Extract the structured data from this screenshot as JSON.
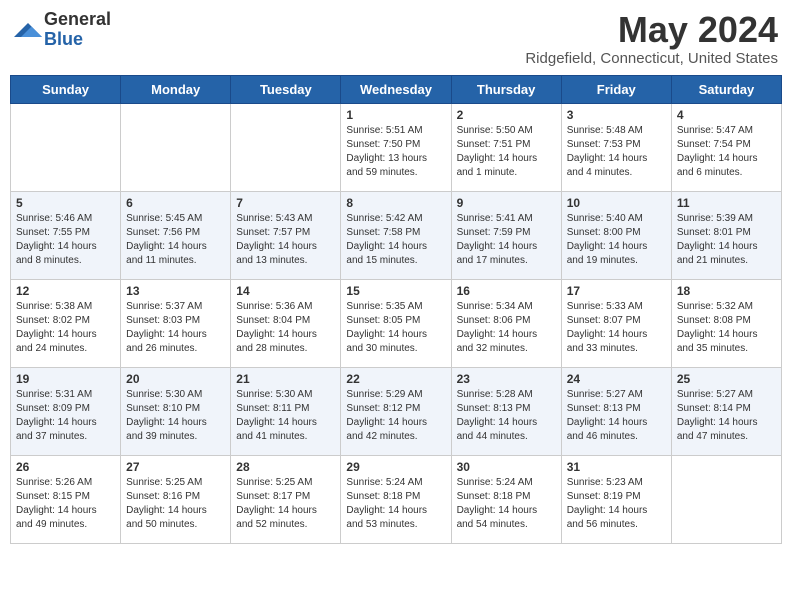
{
  "header": {
    "logo_general": "General",
    "logo_blue": "Blue",
    "month": "May 2024",
    "location": "Ridgefield, Connecticut, United States"
  },
  "days_of_week": [
    "Sunday",
    "Monday",
    "Tuesday",
    "Wednesday",
    "Thursday",
    "Friday",
    "Saturday"
  ],
  "weeks": [
    [
      {
        "day": "",
        "sunrise": "",
        "sunset": "",
        "daylight": ""
      },
      {
        "day": "",
        "sunrise": "",
        "sunset": "",
        "daylight": ""
      },
      {
        "day": "",
        "sunrise": "",
        "sunset": "",
        "daylight": ""
      },
      {
        "day": "1",
        "sunrise": "5:51 AM",
        "sunset": "7:50 PM",
        "daylight": "13 hours and 59 minutes."
      },
      {
        "day": "2",
        "sunrise": "5:50 AM",
        "sunset": "7:51 PM",
        "daylight": "14 hours and 1 minute."
      },
      {
        "day": "3",
        "sunrise": "5:48 AM",
        "sunset": "7:53 PM",
        "daylight": "14 hours and 4 minutes."
      },
      {
        "day": "4",
        "sunrise": "5:47 AM",
        "sunset": "7:54 PM",
        "daylight": "14 hours and 6 minutes."
      }
    ],
    [
      {
        "day": "5",
        "sunrise": "5:46 AM",
        "sunset": "7:55 PM",
        "daylight": "14 hours and 8 minutes."
      },
      {
        "day": "6",
        "sunrise": "5:45 AM",
        "sunset": "7:56 PM",
        "daylight": "14 hours and 11 minutes."
      },
      {
        "day": "7",
        "sunrise": "5:43 AM",
        "sunset": "7:57 PM",
        "daylight": "14 hours and 13 minutes."
      },
      {
        "day": "8",
        "sunrise": "5:42 AM",
        "sunset": "7:58 PM",
        "daylight": "14 hours and 15 minutes."
      },
      {
        "day": "9",
        "sunrise": "5:41 AM",
        "sunset": "7:59 PM",
        "daylight": "14 hours and 17 minutes."
      },
      {
        "day": "10",
        "sunrise": "5:40 AM",
        "sunset": "8:00 PM",
        "daylight": "14 hours and 19 minutes."
      },
      {
        "day": "11",
        "sunrise": "5:39 AM",
        "sunset": "8:01 PM",
        "daylight": "14 hours and 21 minutes."
      }
    ],
    [
      {
        "day": "12",
        "sunrise": "5:38 AM",
        "sunset": "8:02 PM",
        "daylight": "14 hours and 24 minutes."
      },
      {
        "day": "13",
        "sunrise": "5:37 AM",
        "sunset": "8:03 PM",
        "daylight": "14 hours and 26 minutes."
      },
      {
        "day": "14",
        "sunrise": "5:36 AM",
        "sunset": "8:04 PM",
        "daylight": "14 hours and 28 minutes."
      },
      {
        "day": "15",
        "sunrise": "5:35 AM",
        "sunset": "8:05 PM",
        "daylight": "14 hours and 30 minutes."
      },
      {
        "day": "16",
        "sunrise": "5:34 AM",
        "sunset": "8:06 PM",
        "daylight": "14 hours and 32 minutes."
      },
      {
        "day": "17",
        "sunrise": "5:33 AM",
        "sunset": "8:07 PM",
        "daylight": "14 hours and 33 minutes."
      },
      {
        "day": "18",
        "sunrise": "5:32 AM",
        "sunset": "8:08 PM",
        "daylight": "14 hours and 35 minutes."
      }
    ],
    [
      {
        "day": "19",
        "sunrise": "5:31 AM",
        "sunset": "8:09 PM",
        "daylight": "14 hours and 37 minutes."
      },
      {
        "day": "20",
        "sunrise": "5:30 AM",
        "sunset": "8:10 PM",
        "daylight": "14 hours and 39 minutes."
      },
      {
        "day": "21",
        "sunrise": "5:30 AM",
        "sunset": "8:11 PM",
        "daylight": "14 hours and 41 minutes."
      },
      {
        "day": "22",
        "sunrise": "5:29 AM",
        "sunset": "8:12 PM",
        "daylight": "14 hours and 42 minutes."
      },
      {
        "day": "23",
        "sunrise": "5:28 AM",
        "sunset": "8:13 PM",
        "daylight": "14 hours and 44 minutes."
      },
      {
        "day": "24",
        "sunrise": "5:27 AM",
        "sunset": "8:13 PM",
        "daylight": "14 hours and 46 minutes."
      },
      {
        "day": "25",
        "sunrise": "5:27 AM",
        "sunset": "8:14 PM",
        "daylight": "14 hours and 47 minutes."
      }
    ],
    [
      {
        "day": "26",
        "sunrise": "5:26 AM",
        "sunset": "8:15 PM",
        "daylight": "14 hours and 49 minutes."
      },
      {
        "day": "27",
        "sunrise": "5:25 AM",
        "sunset": "8:16 PM",
        "daylight": "14 hours and 50 minutes."
      },
      {
        "day": "28",
        "sunrise": "5:25 AM",
        "sunset": "8:17 PM",
        "daylight": "14 hours and 52 minutes."
      },
      {
        "day": "29",
        "sunrise": "5:24 AM",
        "sunset": "8:18 PM",
        "daylight": "14 hours and 53 minutes."
      },
      {
        "day": "30",
        "sunrise": "5:24 AM",
        "sunset": "8:18 PM",
        "daylight": "14 hours and 54 minutes."
      },
      {
        "day": "31",
        "sunrise": "5:23 AM",
        "sunset": "8:19 PM",
        "daylight": "14 hours and 56 minutes."
      },
      {
        "day": "",
        "sunrise": "",
        "sunset": "",
        "daylight": ""
      }
    ]
  ]
}
